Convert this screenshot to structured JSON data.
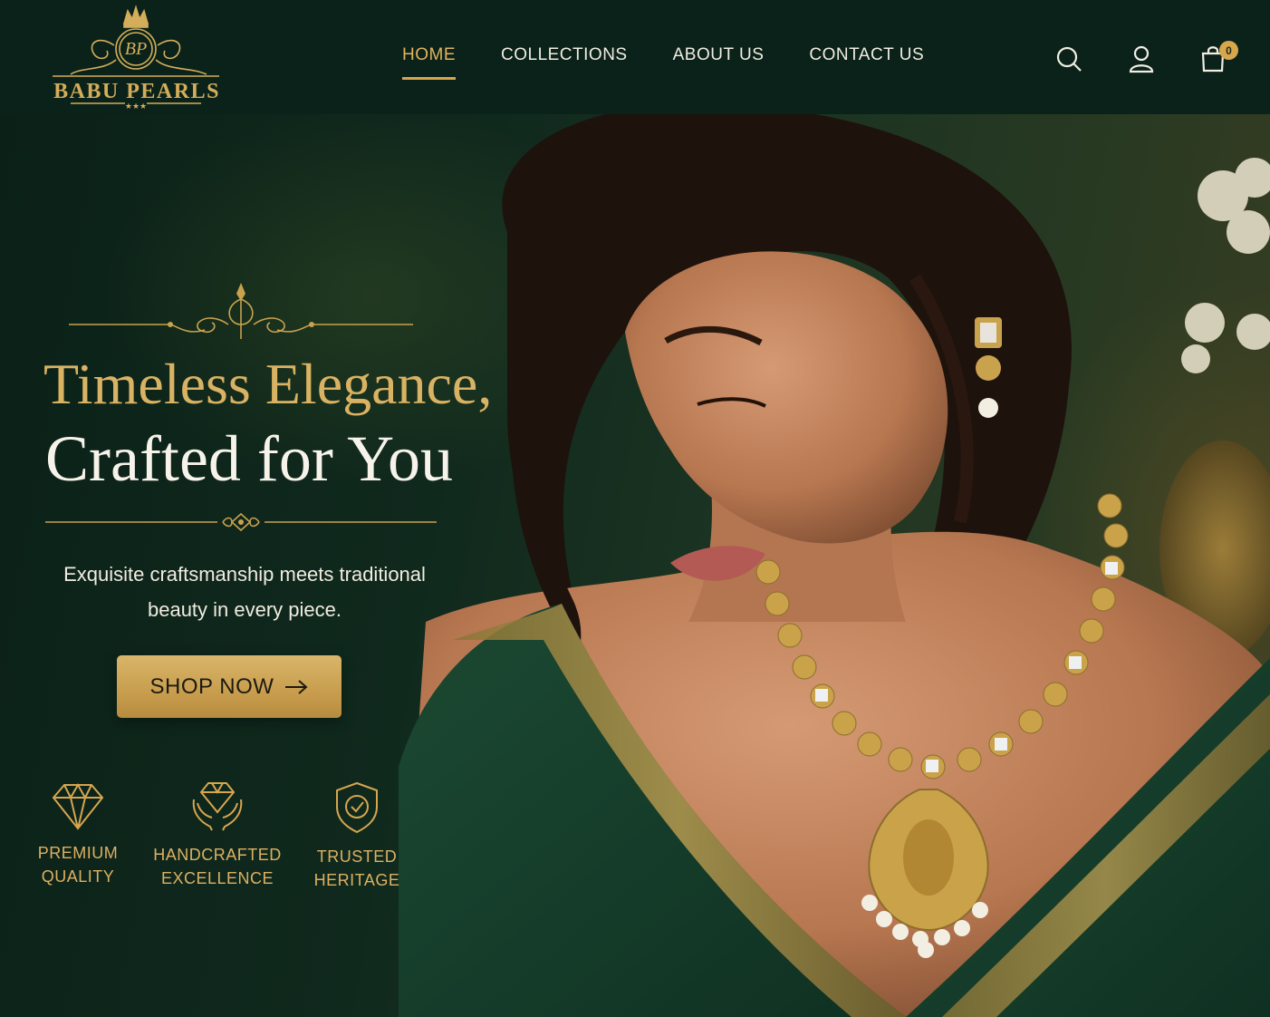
{
  "brand": {
    "name": "BABU PEARLS",
    "monogram": "BP",
    "stars": "★★★"
  },
  "nav": [
    {
      "label": "HOME",
      "active": true
    },
    {
      "label": "COLLECTIONS",
      "active": false
    },
    {
      "label": "ABOUT US",
      "active": false
    },
    {
      "label": "CONTACT US",
      "active": false
    }
  ],
  "header_icons": [
    "search-icon",
    "user-icon",
    "shopping-bag-icon"
  ],
  "cart": {
    "count": "0"
  },
  "hero": {
    "headline_line1": "Timeless Elegance,",
    "headline_line2": "Crafted for You",
    "subtext": "Exquisite craftsmanship meets traditional beauty in every piece.",
    "cta_label": "SHOP NOW"
  },
  "features": [
    {
      "icon": "diamond-icon",
      "label": "PREMIUM\nQUALITY"
    },
    {
      "icon": "hands-diamond-icon",
      "label": "HANDCRAFTED\nEXCELLENCE"
    },
    {
      "icon": "shield-check-icon",
      "label": "TRUSTED\nHERITAGE"
    }
  ],
  "colors": {
    "header_bg": "#0a2219",
    "gold": "#d6a64f",
    "gold_light": "#d9b263",
    "text_light": "#f3efe4",
    "hero_bg": "#10291d"
  }
}
